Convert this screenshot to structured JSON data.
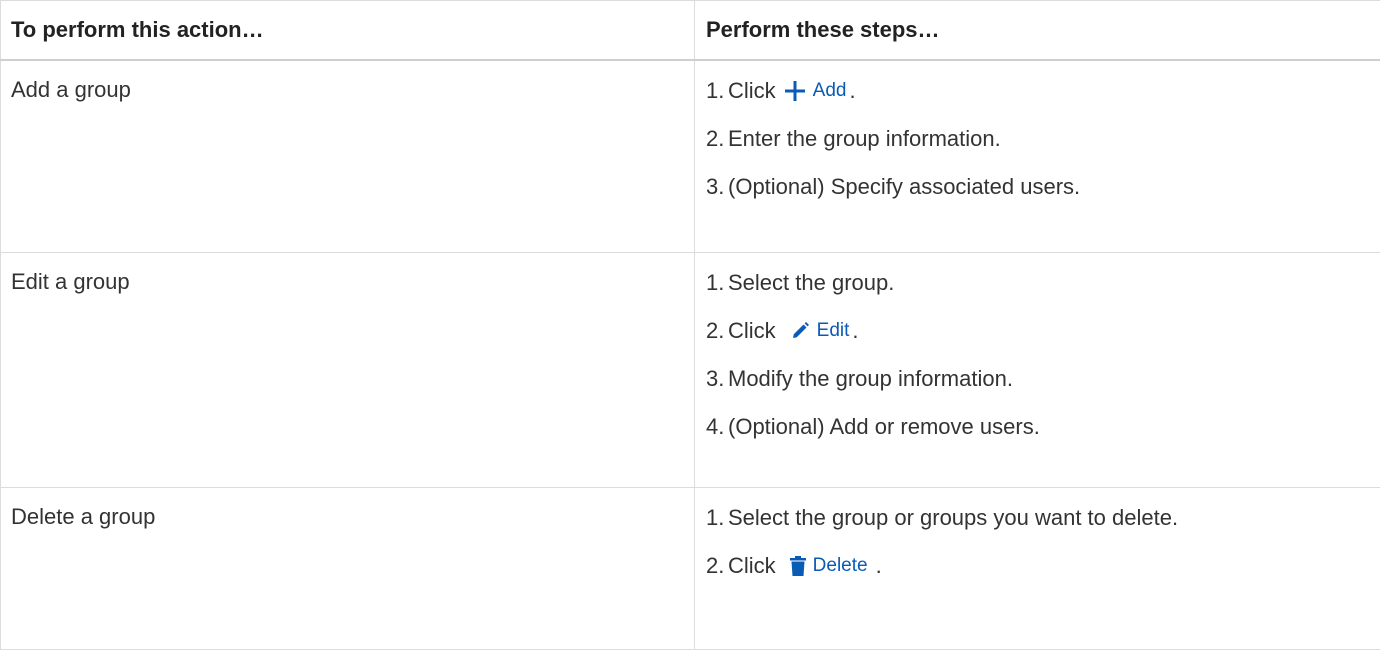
{
  "table": {
    "headers": {
      "action": "To perform this action…",
      "steps": "Perform these steps…"
    },
    "rows": [
      {
        "action": "Add a group",
        "steps": [
          {
            "num": "1.",
            "text": "Click",
            "button": {
              "label": "Add",
              "icon": "plus-icon"
            },
            "suffix": "."
          },
          {
            "num": "2.",
            "text": "Enter the group information."
          },
          {
            "num": "3.",
            "text": "(Optional) Specify associated users."
          }
        ]
      },
      {
        "action": "Edit a group",
        "steps": [
          {
            "num": "1.",
            "text": "Select the group."
          },
          {
            "num": "2.",
            "text": "Click",
            "button": {
              "label": "Edit",
              "icon": "pencil-icon"
            },
            "suffix": "."
          },
          {
            "num": "3.",
            "text": "Modify the group information."
          },
          {
            "num": "4.",
            "text": "(Optional) Add or remove users."
          }
        ]
      },
      {
        "action": "Delete a group",
        "steps": [
          {
            "num": "1.",
            "text": "Select the group or groups you want to delete."
          },
          {
            "num": "2.",
            "text": "Click",
            "button": {
              "label": "Delete",
              "icon": "trash-icon"
            },
            "suffix": "."
          }
        ]
      }
    ]
  },
  "colors": {
    "button_accent": "#0a5bb5",
    "border": "#dcdcdc",
    "text": "#333333"
  }
}
